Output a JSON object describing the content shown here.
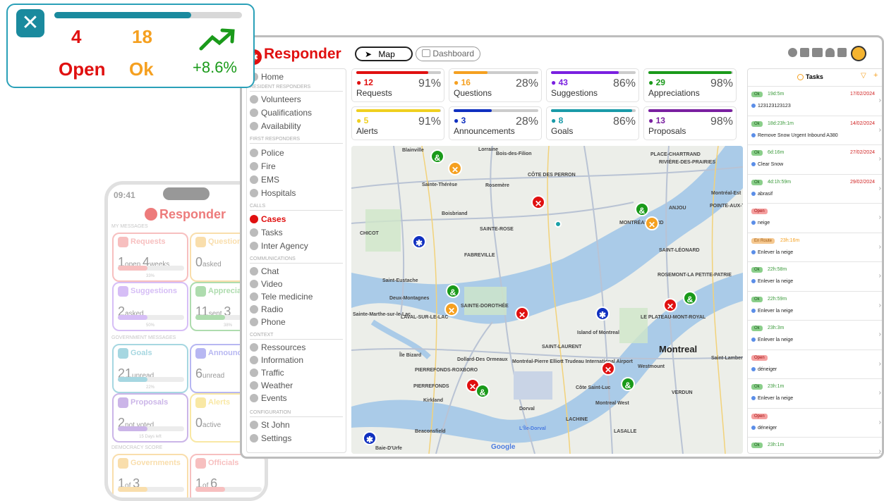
{
  "stat_card": {
    "open_count": "4",
    "open_label": "Open",
    "ok_count": "18",
    "ok_label": "Ok",
    "trend": "+8.6%",
    "progress": 0.73
  },
  "phone": {
    "time": "09:41",
    "brand": "Responder",
    "sections": [
      "MY MESSAGES",
      "GOVERNMENT MESSAGES",
      "DEMOCRACY SCORE"
    ],
    "cards": [
      {
        "title": "Requests",
        "n1": "1",
        "t1": "open",
        "n2": "4",
        "t2": "weeks",
        "pct": "33%",
        "color": "#f28b8b"
      },
      {
        "title": "Questions",
        "n1": "0",
        "t1": "asked",
        "color": "#f5c46a"
      },
      {
        "title": "Suggestions",
        "n1": "2",
        "t1": "asked",
        "pct": "50%",
        "color": "#b58af0"
      },
      {
        "title": "Appreciations",
        "n1": "11",
        "t1": "sent",
        "n2": "3",
        "t2": "",
        "pct": "38%",
        "color": "#6cc06c"
      },
      {
        "title": "Goals",
        "n1": "21",
        "t1": "unread",
        "pct": "22%",
        "color": "#5fb8c9"
      },
      {
        "title": "Announcements",
        "n1": "6",
        "t1": "unread",
        "color": "#7d7de8"
      },
      {
        "title": "Proposals",
        "n1": "2",
        "t1": "not voted",
        "pct": "15 Days left",
        "color": "#a27ad6"
      },
      {
        "title": "Alerts",
        "n1": "0",
        "t1": "active",
        "color": "#f5d65a"
      },
      {
        "title": "Governments",
        "n1": "1",
        "t1": "of",
        "n2": "3",
        "t2": "",
        "pct": "",
        "color": "#f5c46a"
      },
      {
        "title": "Officials",
        "n1": "1",
        "t1": "of",
        "n2": "6",
        "t2": "",
        "pct": "",
        "color": "#f28b8b"
      }
    ]
  },
  "header": {
    "brand": "Responder",
    "map_label": "Map",
    "dashboard_label": "Dashboard"
  },
  "menu": {
    "home": "Home",
    "sec_resident": "RESIDENT RESPONDERS",
    "volunteers": "Volunteers",
    "qualifications": "Qualifications",
    "availability": "Availability",
    "sec_first": "FIRST RESPONDERS",
    "police": "Police",
    "fire": "Fire",
    "ems": "EMS",
    "hospitals": "Hospitals",
    "sec_calls": "CALLS",
    "cases": "Cases",
    "tasks": "Tasks",
    "inter_agency": "Inter Agency",
    "sec_comm": "COMMUNICATIONS",
    "chat": "Chat",
    "video": "Video",
    "tele": "Tele medicine",
    "radio": "Radio",
    "phone": "Phone",
    "sec_context": "CONTEXT",
    "ressources": "Ressources",
    "information": "Information",
    "traffic": "Traffic",
    "weather": "Weather",
    "events": "Events",
    "sec_config": "CONFIGURATION",
    "stjohn": "St John",
    "settings": "Settings"
  },
  "tiles": [
    {
      "count": "12",
      "label": "Requests",
      "pct": "91%",
      "color": "#e01010",
      "fill": 0.85
    },
    {
      "count": "16",
      "label": "Questions",
      "pct": "28%",
      "color": "#f5a020",
      "fill": 0.4
    },
    {
      "count": "43",
      "label": "Suggestions",
      "pct": "86%",
      "color": "#7a20e0",
      "fill": 0.8
    },
    {
      "count": "29",
      "label": "Appreciations",
      "pct": "98%",
      "color": "#1a9a1a",
      "fill": 0.98
    },
    {
      "count": "5",
      "label": "Alerts",
      "pct": "91%",
      "color": "#f0d020",
      "fill": 0.99
    },
    {
      "count": "3",
      "label": "Announcements",
      "pct": "28%",
      "color": "#1030c0",
      "fill": 0.45
    },
    {
      "count": "8",
      "label": "Goals",
      "pct": "86%",
      "color": "#1a9aa8",
      "fill": 0.96
    },
    {
      "count": "13",
      "label": "Proposals",
      "pct": "98%",
      "color": "#7a20a0",
      "fill": 0.99
    }
  ],
  "map": {
    "city": "Montreal",
    "attribution": "Google",
    "labels": [
      "Blainville",
      "Lorraine",
      "Bois-des-Filion",
      "Sainte-Thérèse",
      "Rosemère",
      "Boisbriand",
      "CÔTE DES PERRON",
      "SAINTE-ROSE",
      "FABREVILLE",
      "ANJOU",
      "MONTRÉAL-NORD",
      "SAINT-LÉONARD",
      "ROSEMONT-LA PETITE-PATRIE",
      "Saint-Eustache",
      "Deux-Montagnes",
      "SAINTE-DOROTHÉE",
      "LAVAL-SUR-LE-LAC",
      "Sainte-Marthe-sur-le-Lac",
      "Island of Montreal",
      "LE PLATEAU-MONT-ROYAL",
      "SAINT-LAURENT",
      "Westmount",
      "Saint-Lambert",
      "Île Bizard",
      "Dollard-Des Ormeaux",
      "PIERREFONDS-ROXBORO",
      "PIERREFONDS",
      "Kirkland",
      "Montréal-Pierre Elliott Trudeau International Airport",
      "Côte Saint-Luc",
      "Montreal West",
      "Dorval",
      "L'Île-Dorval",
      "LACHINE",
      "Beaconsfield",
      "Baie-D'Urfe",
      "LASALLE",
      "VERDUN",
      "POINTE-AUX-TREMBLES",
      "PLACE-CHARTRAND",
      "RIVIÈRE-DES-PRAIRIES",
      "CHICOT",
      "Montréal-Est"
    ]
  },
  "tasks_panel": {
    "title": "Tasks",
    "items": [
      {
        "status": "Ok",
        "time": "19d:5m",
        "date": "17/02/2024",
        "name": "123123123123"
      },
      {
        "status": "Ok",
        "time": "18d:23h:1m",
        "date": "14/02/2024",
        "name": "Remove Snow Urgent Inbound A380"
      },
      {
        "status": "Ok",
        "time": "6d:16m",
        "date": "27/02/2024",
        "name": "Clear Snow"
      },
      {
        "status": "Ok",
        "time": "4d:1h:59m",
        "date": "29/02/2024",
        "name": "abrasif"
      },
      {
        "status": "Open",
        "time": "",
        "date": "",
        "name": "neige"
      },
      {
        "status": "En Route",
        "time": "23h:16m",
        "date": "",
        "name": "Enlever la neige"
      },
      {
        "status": "Ok",
        "time": "22h:58m",
        "date": "",
        "name": "Enlever la neige"
      },
      {
        "status": "Ok",
        "time": "22h:59m",
        "date": "",
        "name": "Enlever la neige"
      },
      {
        "status": "Ok",
        "time": "23h:3m",
        "date": "",
        "name": "Enlever la neige"
      },
      {
        "status": "Open",
        "time": "",
        "date": "",
        "name": "déneiger"
      },
      {
        "status": "Ok",
        "time": "23h:1m",
        "date": "",
        "name": "Enlever la neige"
      },
      {
        "status": "Open",
        "time": "",
        "date": "",
        "name": "déneiger"
      },
      {
        "status": "Ok",
        "time": "23h:1m",
        "date": "",
        "name": "Enlever la neige"
      }
    ]
  }
}
